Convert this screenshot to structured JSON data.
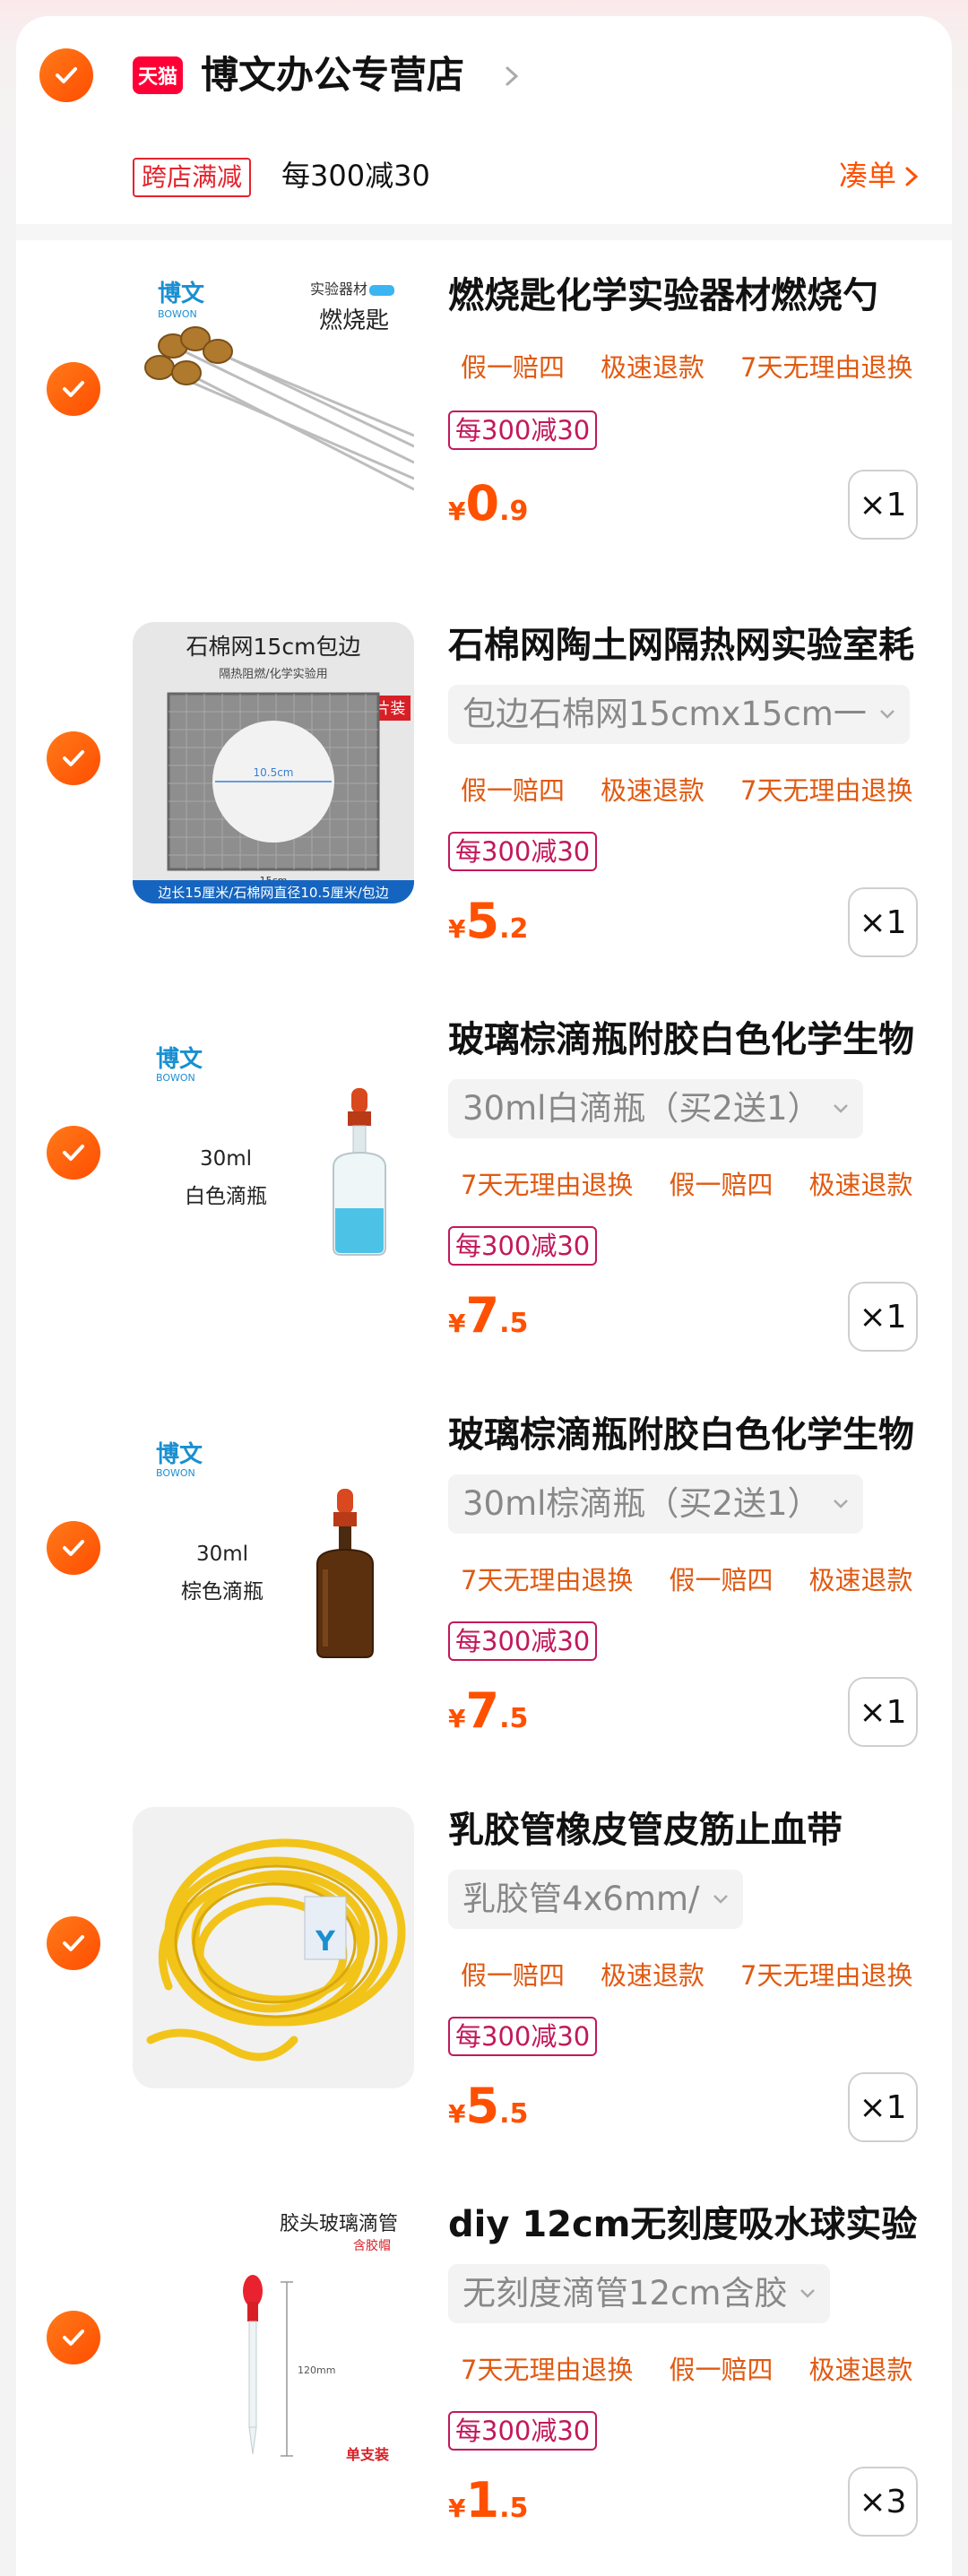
{
  "store": {
    "platform_badge": "天猫",
    "name": "博文办公专营店",
    "promo_tag": "跨店满减",
    "promo_text": "每300减30",
    "cou_dan": "凑单"
  },
  "colors": {
    "accent": "#ff5000",
    "check": "#ff6a00",
    "tmall": "#ff0036",
    "promo_border": "#c2185b"
  },
  "items": [
    {
      "title": "燃烧匙化学实验器材燃烧勺",
      "sku": "",
      "tags": [
        "假一赔四",
        "极速退款",
        "7天无理由退换"
      ],
      "promo": "每300减30",
      "price_symbol": "¥",
      "price_int": "0",
      "price_dec": ".9",
      "qty": "×1",
      "image": {
        "brand": "博文",
        "brand_en": "BOWON",
        "label1": "实验器材",
        "label2": "燃烧匙"
      }
    },
    {
      "title": "石棉网陶土网隔热网实验室耗",
      "sku": "包边石棉网15cmx15cm一",
      "tags": [
        "假一赔四",
        "极速退款",
        "7天无理由退换"
      ],
      "promo": "每300减30",
      "price_symbol": "¥",
      "price_int": "5",
      "price_dec": ".2",
      "qty": "×1",
      "image": {
        "label1": "石棉网15cm包边",
        "label2": "隔热阻燃/化学实验用",
        "badge": "1片装",
        "center": "10.5cm",
        "bottom_dim": "15cm",
        "footer": "边长15厘米/石棉网直径10.5厘米/包边"
      }
    },
    {
      "title": "玻璃棕滴瓶附胶白色化学生物",
      "sku": "30ml白滴瓶（买2送1）",
      "tags": [
        "7天无理由退换",
        "假一赔四",
        "极速退款"
      ],
      "promo": "每300减30",
      "price_symbol": "¥",
      "price_int": "7",
      "price_dec": ".5",
      "qty": "×1",
      "image": {
        "brand": "博文",
        "brand_en": "BOWON",
        "label1": "30ml",
        "label2": "白色滴瓶"
      }
    },
    {
      "title": "玻璃棕滴瓶附胶白色化学生物",
      "sku": "30ml棕滴瓶（买2送1）",
      "tags": [
        "7天无理由退换",
        "假一赔四",
        "极速退款"
      ],
      "promo": "每300减30",
      "price_symbol": "¥",
      "price_int": "7",
      "price_dec": ".5",
      "qty": "×1",
      "image": {
        "brand": "博文",
        "brand_en": "BOWON",
        "label1": "30ml",
        "label2": "棕色滴瓶"
      }
    },
    {
      "title": "乳胶管橡皮管皮筋止血带",
      "sku": "乳胶管4x6mm/",
      "tags": [
        "假一赔四",
        "极速退款",
        "7天无理由退换"
      ],
      "promo": "每300减30",
      "price_symbol": "¥",
      "price_int": "5",
      "price_dec": ".5",
      "qty": "×1",
      "image": {}
    },
    {
      "title": "diy 12cm无刻度吸水球实验",
      "sku": "无刻度滴管12cm含胶",
      "tags": [
        "7天无理由退换",
        "假一赔四",
        "极速退款"
      ],
      "promo": "每300减30",
      "price_symbol": "¥",
      "price_int": "1",
      "price_dec": ".5",
      "qty": "×3",
      "image": {
        "label1": "胶头玻璃滴管",
        "label2": "含胶帽",
        "dim": "120mm",
        "footer": "单支装"
      }
    }
  ]
}
